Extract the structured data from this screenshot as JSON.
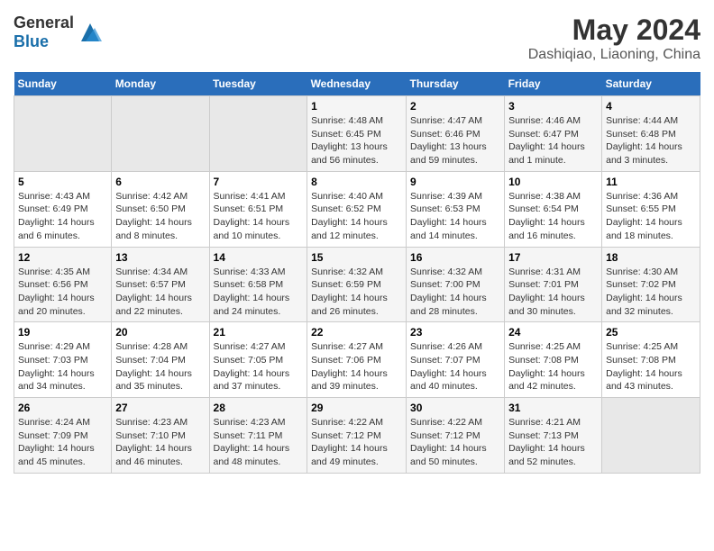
{
  "header": {
    "logo_general": "General",
    "logo_blue": "Blue",
    "title": "May 2024",
    "subtitle": "Dashiqiao, Liaoning, China"
  },
  "columns": [
    "Sunday",
    "Monday",
    "Tuesday",
    "Wednesday",
    "Thursday",
    "Friday",
    "Saturday"
  ],
  "weeks": [
    {
      "days": [
        {
          "number": "",
          "detail": "",
          "empty": true
        },
        {
          "number": "",
          "detail": "",
          "empty": true
        },
        {
          "number": "",
          "detail": "",
          "empty": true
        },
        {
          "number": "1",
          "detail": "Sunrise: 4:48 AM\nSunset: 6:45 PM\nDaylight: 13 hours and 56 minutes."
        },
        {
          "number": "2",
          "detail": "Sunrise: 4:47 AM\nSunset: 6:46 PM\nDaylight: 13 hours and 59 minutes."
        },
        {
          "number": "3",
          "detail": "Sunrise: 4:46 AM\nSunset: 6:47 PM\nDaylight: 14 hours and 1 minute."
        },
        {
          "number": "4",
          "detail": "Sunrise: 4:44 AM\nSunset: 6:48 PM\nDaylight: 14 hours and 3 minutes."
        }
      ]
    },
    {
      "days": [
        {
          "number": "5",
          "detail": "Sunrise: 4:43 AM\nSunset: 6:49 PM\nDaylight: 14 hours and 6 minutes."
        },
        {
          "number": "6",
          "detail": "Sunrise: 4:42 AM\nSunset: 6:50 PM\nDaylight: 14 hours and 8 minutes."
        },
        {
          "number": "7",
          "detail": "Sunrise: 4:41 AM\nSunset: 6:51 PM\nDaylight: 14 hours and 10 minutes."
        },
        {
          "number": "8",
          "detail": "Sunrise: 4:40 AM\nSunset: 6:52 PM\nDaylight: 14 hours and 12 minutes."
        },
        {
          "number": "9",
          "detail": "Sunrise: 4:39 AM\nSunset: 6:53 PM\nDaylight: 14 hours and 14 minutes."
        },
        {
          "number": "10",
          "detail": "Sunrise: 4:38 AM\nSunset: 6:54 PM\nDaylight: 14 hours and 16 minutes."
        },
        {
          "number": "11",
          "detail": "Sunrise: 4:36 AM\nSunset: 6:55 PM\nDaylight: 14 hours and 18 minutes."
        }
      ]
    },
    {
      "days": [
        {
          "number": "12",
          "detail": "Sunrise: 4:35 AM\nSunset: 6:56 PM\nDaylight: 14 hours and 20 minutes."
        },
        {
          "number": "13",
          "detail": "Sunrise: 4:34 AM\nSunset: 6:57 PM\nDaylight: 14 hours and 22 minutes."
        },
        {
          "number": "14",
          "detail": "Sunrise: 4:33 AM\nSunset: 6:58 PM\nDaylight: 14 hours and 24 minutes."
        },
        {
          "number": "15",
          "detail": "Sunrise: 4:32 AM\nSunset: 6:59 PM\nDaylight: 14 hours and 26 minutes."
        },
        {
          "number": "16",
          "detail": "Sunrise: 4:32 AM\nSunset: 7:00 PM\nDaylight: 14 hours and 28 minutes."
        },
        {
          "number": "17",
          "detail": "Sunrise: 4:31 AM\nSunset: 7:01 PM\nDaylight: 14 hours and 30 minutes."
        },
        {
          "number": "18",
          "detail": "Sunrise: 4:30 AM\nSunset: 7:02 PM\nDaylight: 14 hours and 32 minutes."
        }
      ]
    },
    {
      "days": [
        {
          "number": "19",
          "detail": "Sunrise: 4:29 AM\nSunset: 7:03 PM\nDaylight: 14 hours and 34 minutes."
        },
        {
          "number": "20",
          "detail": "Sunrise: 4:28 AM\nSunset: 7:04 PM\nDaylight: 14 hours and 35 minutes."
        },
        {
          "number": "21",
          "detail": "Sunrise: 4:27 AM\nSunset: 7:05 PM\nDaylight: 14 hours and 37 minutes."
        },
        {
          "number": "22",
          "detail": "Sunrise: 4:27 AM\nSunset: 7:06 PM\nDaylight: 14 hours and 39 minutes."
        },
        {
          "number": "23",
          "detail": "Sunrise: 4:26 AM\nSunset: 7:07 PM\nDaylight: 14 hours and 40 minutes."
        },
        {
          "number": "24",
          "detail": "Sunrise: 4:25 AM\nSunset: 7:08 PM\nDaylight: 14 hours and 42 minutes."
        },
        {
          "number": "25",
          "detail": "Sunrise: 4:25 AM\nSunset: 7:08 PM\nDaylight: 14 hours and 43 minutes."
        }
      ]
    },
    {
      "days": [
        {
          "number": "26",
          "detail": "Sunrise: 4:24 AM\nSunset: 7:09 PM\nDaylight: 14 hours and 45 minutes."
        },
        {
          "number": "27",
          "detail": "Sunrise: 4:23 AM\nSunset: 7:10 PM\nDaylight: 14 hours and 46 minutes."
        },
        {
          "number": "28",
          "detail": "Sunrise: 4:23 AM\nSunset: 7:11 PM\nDaylight: 14 hours and 48 minutes."
        },
        {
          "number": "29",
          "detail": "Sunrise: 4:22 AM\nSunset: 7:12 PM\nDaylight: 14 hours and 49 minutes."
        },
        {
          "number": "30",
          "detail": "Sunrise: 4:22 AM\nSunset: 7:12 PM\nDaylight: 14 hours and 50 minutes."
        },
        {
          "number": "31",
          "detail": "Sunrise: 4:21 AM\nSunset: 7:13 PM\nDaylight: 14 hours and 52 minutes."
        },
        {
          "number": "",
          "detail": "",
          "empty": true
        }
      ]
    }
  ]
}
